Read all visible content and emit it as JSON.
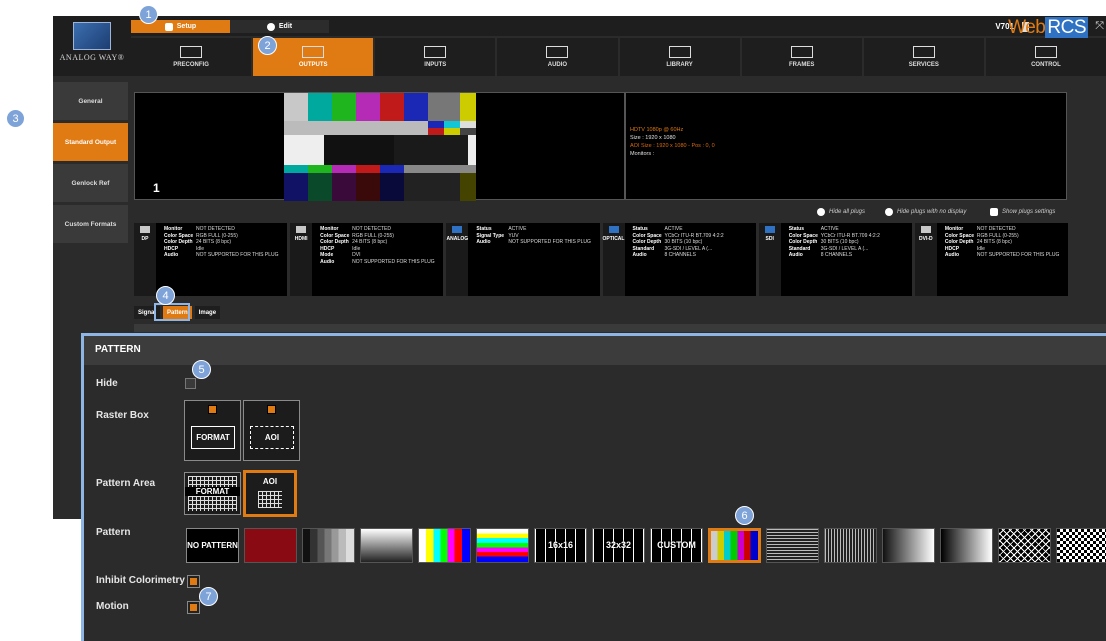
{
  "brand": {
    "logo_text": "ANALOG WAY®",
    "version": "V701",
    "app_name_a": "Web",
    "app_name_b": "RCS"
  },
  "modes": {
    "setup": "Setup",
    "edit": "Edit"
  },
  "tabs": [
    {
      "label": "PRECONFIG"
    },
    {
      "label": "OUTPUTS"
    },
    {
      "label": "INPUTS"
    },
    {
      "label": "AUDIO"
    },
    {
      "label": "LIBRARY"
    },
    {
      "label": "FRAMES"
    },
    {
      "label": "SERVICES"
    },
    {
      "label": "CONTROL"
    }
  ],
  "sidebar": [
    "General",
    "Standard Output",
    "Genlock Ref",
    "Custom Formats"
  ],
  "preview": {
    "number": "1"
  },
  "output_info": {
    "format": "HDTV 1080p @ 60Hz",
    "size": "Size : 1920 x 1080",
    "aoi": "AOI Size : 1920 x 1080 - Pos : 0, 0",
    "monitors": "Monitors :"
  },
  "plug_options": {
    "hide_all": "Hide all plugs",
    "hide_no_display": "Hide plugs with no display",
    "show_settings": "Show plugs settings"
  },
  "plugs": [
    {
      "name": "DP",
      "rows": [
        [
          "Monitor",
          "NOT DETECTED"
        ],
        [
          "Color Space",
          "RGB FULL (0-255)"
        ],
        [
          "Color Depth",
          "24 BITS (8 bpc)"
        ],
        [
          "",
          ""
        ],
        [
          "HDCP",
          "Idle"
        ],
        [
          "",
          ""
        ],
        [
          "Audio",
          "NOT SUPPORTED FOR THIS PLUG"
        ]
      ]
    },
    {
      "name": "HDMI",
      "rows": [
        [
          "Monitor",
          "NOT DETECTED"
        ],
        [
          "Color Space",
          "RGB FULL (0-255)"
        ],
        [
          "Color Depth",
          "24 BITS (8 bpc)"
        ],
        [
          "",
          ""
        ],
        [
          "HDCP",
          "Idle"
        ],
        [
          "Mode",
          "DVI"
        ],
        [
          "Audio",
          "NOT SUPPORTED FOR THIS PLUG"
        ]
      ]
    },
    {
      "name": "ANALOG",
      "rows": [
        [
          "Status",
          "ACTIVE"
        ],
        [
          "Signal Type",
          "YUV"
        ],
        [
          "",
          ""
        ],
        [
          "",
          ""
        ],
        [
          "",
          ""
        ],
        [
          "",
          ""
        ],
        [
          "Audio",
          "NOT SUPPORTED FOR THIS PLUG"
        ]
      ]
    },
    {
      "name": "OPTICAL",
      "rows": [
        [
          "Status",
          "ACTIVE"
        ],
        [
          "Color Space",
          "YCbCr ITU-R BT.709 4:2:2"
        ],
        [
          "Color Depth",
          "30 BITS (10 bpc)"
        ],
        [
          "Standard",
          "3G-SDI / LEVEL A (..."
        ],
        [
          "",
          ""
        ],
        [
          "",
          ""
        ],
        [
          "Audio",
          "8 CHANNELS"
        ]
      ]
    },
    {
      "name": "SDI",
      "rows": [
        [
          "Status",
          "ACTIVE"
        ],
        [
          "Color Space",
          "YCbCr ITU-R BT.709 4:2:2"
        ],
        [
          "Color Depth",
          "30 BITS (10 bpc)"
        ],
        [
          "Standard",
          "3G-SDI / LEVEL A (..."
        ],
        [
          "",
          ""
        ],
        [
          "",
          ""
        ],
        [
          "Audio",
          "8 CHANNELS"
        ]
      ]
    },
    {
      "name": "DVI-D",
      "rows": [
        [
          "Monitor",
          "NOT DETECTED"
        ],
        [
          "Color Space",
          "RGB FULL (0-255)"
        ],
        [
          "Color Depth",
          "24 BITS (8 bpc)"
        ],
        [
          "",
          ""
        ],
        [
          "HDCP",
          "Idle"
        ],
        [
          "",
          ""
        ],
        [
          "Audio",
          "NOT SUPPORTED FOR THIS PLUG"
        ]
      ]
    }
  ],
  "subtabs": [
    "Signal",
    "Pattern",
    "Image"
  ],
  "pattern_panel": {
    "title": "PATTERN",
    "hide_label": "Hide",
    "raster_box_label": "Raster Box",
    "raster_box": [
      "FORMAT",
      "AOI"
    ],
    "pattern_area_label": "Pattern Area",
    "pattern_area": [
      "FORMAT",
      "AOI"
    ],
    "pattern_label": "Pattern",
    "patterns": [
      "NO PATTERN",
      "red",
      "grey-steps",
      "h-ramp",
      "colorbars",
      "h-colorbars",
      "16x16",
      "32x32",
      "CUSTOM",
      "smpte",
      "h-lines",
      "v-lines",
      "h-gradient",
      "h-gradient-2",
      "crosshatch",
      "checker"
    ],
    "selected_pattern": "smpte",
    "inhibit_label": "Inhibit Colorimetry",
    "motion_label": "Motion"
  },
  "callouts": [
    "1",
    "2",
    "3",
    "4",
    "5",
    "6",
    "7"
  ],
  "colors": {
    "accent": "#e07a12",
    "highlight": "#8fb5e6",
    "callout": "#7ea3d8"
  }
}
